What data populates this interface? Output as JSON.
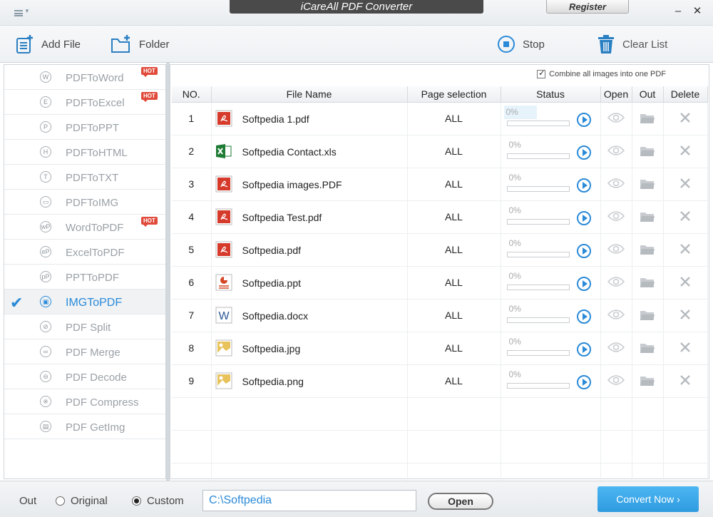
{
  "window": {
    "title": "iCareAll PDF Converter",
    "register_label": "Register",
    "minimize": "–",
    "close": "✕"
  },
  "toolbar": {
    "add_file": "Add File",
    "folder": "Folder",
    "stop": "Stop",
    "clear_list": "Clear List"
  },
  "sidebar": {
    "items": [
      {
        "label": "PDFToWord",
        "glyph": "W",
        "hot": "HOT"
      },
      {
        "label": "PDFToExcel",
        "glyph": "E",
        "hot": "HOT"
      },
      {
        "label": "PDFToPPT",
        "glyph": "P"
      },
      {
        "label": "PDFToHTML",
        "glyph": "H"
      },
      {
        "label": "PDFToTXT",
        "glyph": "T"
      },
      {
        "label": "PDFToIMG",
        "glyph": "▭"
      },
      {
        "label": "WordToPDF",
        "glyph": "wP",
        "hot": "HOT"
      },
      {
        "label": "ExcelToPDF",
        "glyph": "eP"
      },
      {
        "label": "PPTToPDF",
        "glyph": "pP"
      },
      {
        "label": "IMGToPDF",
        "glyph": "▣",
        "active": true
      },
      {
        "label": "PDF Split",
        "glyph": "⊘"
      },
      {
        "label": "PDF Merge",
        "glyph": "∞"
      },
      {
        "label": "PDF Decode",
        "glyph": "⊖"
      },
      {
        "label": "PDF Compress",
        "glyph": "※"
      },
      {
        "label": "PDF GetImg",
        "glyph": "▤"
      }
    ]
  },
  "main": {
    "combine_label": "Combine all images into one PDF",
    "combine_checked": true,
    "columns": {
      "no": "NO.",
      "file_name": "File Name",
      "page_selection": "Page selection",
      "status": "Status",
      "open": "Open",
      "out": "Out",
      "delete": "Delete"
    },
    "rows": [
      {
        "no": "1",
        "name": "Softpedia 1.pdf",
        "type": "pdf",
        "pages": "ALL",
        "progress": "0%"
      },
      {
        "no": "2",
        "name": "Softpedia Contact.xls",
        "type": "xls",
        "pages": "ALL",
        "progress": "0%"
      },
      {
        "no": "3",
        "name": "Softpedia images.PDF",
        "type": "pdf",
        "pages": "ALL",
        "progress": "0%"
      },
      {
        "no": "4",
        "name": "Softpedia Test.pdf",
        "type": "pdf",
        "pages": "ALL",
        "progress": "0%"
      },
      {
        "no": "5",
        "name": "Softpedia.pdf",
        "type": "pdf",
        "pages": "ALL",
        "progress": "0%"
      },
      {
        "no": "6",
        "name": "Softpedia.ppt",
        "type": "ppt",
        "pages": "ALL",
        "progress": "0%"
      },
      {
        "no": "7",
        "name": "Softpedia.docx",
        "type": "docx",
        "pages": "ALL",
        "progress": "0%"
      },
      {
        "no": "8",
        "name": "Softpedia.jpg",
        "type": "img",
        "pages": "ALL",
        "progress": "0%"
      },
      {
        "no": "9",
        "name": "Softpedia.png",
        "type": "img",
        "pages": "ALL",
        "progress": "0%"
      }
    ]
  },
  "bottom": {
    "out_label": "Out",
    "original_label": "Original",
    "custom_label": "Custom",
    "selected": "custom",
    "path_value": "C:\\Softpedia",
    "open_label": "Open",
    "convert_label": "Convert Now ›"
  },
  "colors": {
    "accent": "#2a8ad8",
    "convert": "#3aa7e8",
    "pdf_red": "#d63a2b",
    "xls_green": "#1e7b34"
  }
}
